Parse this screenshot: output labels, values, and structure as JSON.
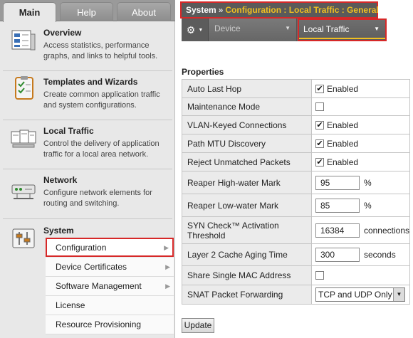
{
  "tabs": [
    "Main",
    "Help",
    "About"
  ],
  "breadcrumb": {
    "root": "System",
    "separator": "»",
    "trail": "Configuration : Local Traffic : General"
  },
  "toolbar": {
    "gear_icon": "gear-icon",
    "device_label": "Device",
    "local_traffic_label": "Local Traffic"
  },
  "nav": {
    "overview": {
      "title": "Overview",
      "desc": "Access statistics, performance graphs, and links to helpful tools."
    },
    "templates": {
      "title": "Templates and Wizards",
      "desc": "Create common application traffic and system configurations."
    },
    "local_traffic": {
      "title": "Local Traffic",
      "desc": "Control the delivery of application traffic for a local area network."
    },
    "network": {
      "title": "Network",
      "desc": "Configure network elements for routing and switching."
    },
    "system": {
      "title": "System",
      "items": [
        {
          "label": "Configuration",
          "selected": true
        },
        {
          "label": "Device Certificates"
        },
        {
          "label": "Software Management"
        },
        {
          "label": "License"
        },
        {
          "label": "Resource Provisioning"
        }
      ]
    }
  },
  "properties": {
    "heading": "Properties",
    "rows": [
      {
        "label": "Auto Last Hop",
        "type": "checkbox",
        "checked": true,
        "text": "Enabled"
      },
      {
        "label": "Maintenance Mode",
        "type": "checkbox",
        "checked": false,
        "text": ""
      },
      {
        "label": "VLAN-Keyed Connections",
        "type": "checkbox",
        "checked": true,
        "text": "Enabled"
      },
      {
        "label": "Path MTU Discovery",
        "type": "checkbox",
        "checked": true,
        "text": "Enabled"
      },
      {
        "label": "Reject Unmatched Packets",
        "type": "checkbox",
        "checked": true,
        "text": "Enabled"
      },
      {
        "label": "Reaper High-water Mark",
        "type": "text",
        "value": "95",
        "unit": "%"
      },
      {
        "label": "Reaper Low-water Mark",
        "type": "text",
        "value": "85",
        "unit": "%"
      },
      {
        "label": "SYN Check™ Activation Threshold",
        "type": "text",
        "value": "16384",
        "unit": "connections"
      },
      {
        "label": "Layer 2 Cache Aging Time",
        "type": "text",
        "value": "300",
        "unit": "seconds"
      },
      {
        "label": "Share Single MAC Address",
        "type": "checkbox",
        "checked": false,
        "text": ""
      },
      {
        "label": "SNAT Packet Forwarding",
        "type": "select",
        "value": "TCP and UDP Only"
      }
    ]
  },
  "update_label": "Update",
  "colors": {
    "highlight": "#d62828",
    "accent": "#f0c020"
  }
}
